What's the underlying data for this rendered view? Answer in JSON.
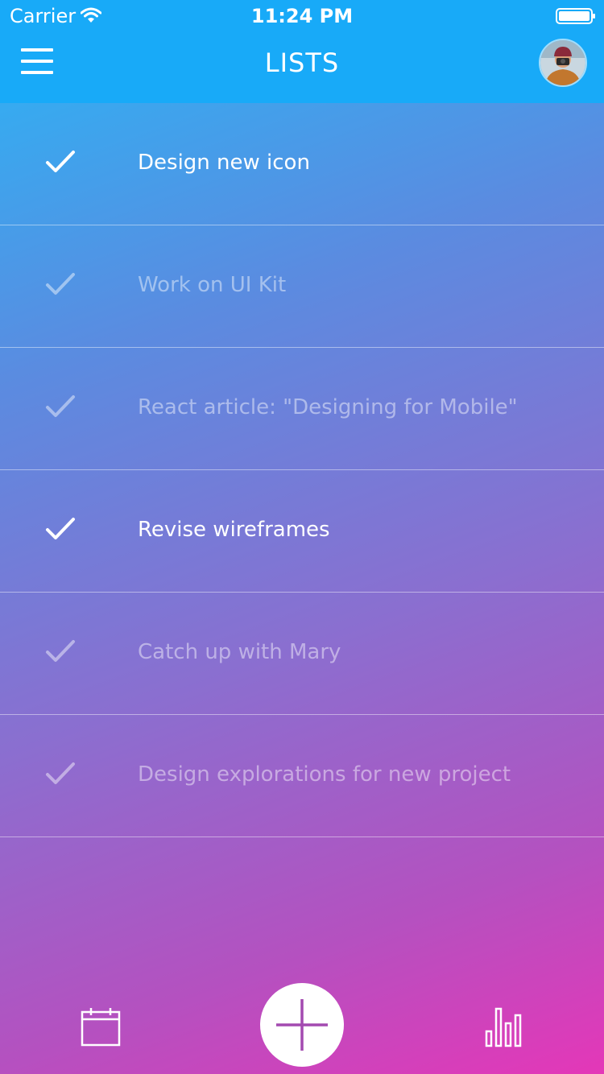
{
  "status_bar": {
    "carrier": "Carrier",
    "time": "11:24 PM",
    "icons": [
      "wifi-icon",
      "battery-icon"
    ]
  },
  "header": {
    "title": "LISTS",
    "menu_icon": "hamburger-menu-icon",
    "avatar": "user-avatar"
  },
  "tasks": [
    {
      "label": "Design new icon",
      "completed": true
    },
    {
      "label": "Work on UI Kit",
      "completed": false
    },
    {
      "label": "React article: \"Designing for Mobile\"",
      "completed": false
    },
    {
      "label": "Revise wireframes",
      "completed": true
    },
    {
      "label": "Catch up with Mary",
      "completed": false
    },
    {
      "label": "Design explorations for new project",
      "completed": false
    }
  ],
  "bottom_bar": {
    "left_icon": "calendar-icon",
    "center_icon": "plus-icon",
    "right_icon": "bar-chart-icon"
  },
  "colors": {
    "header": "#18aaf8",
    "gradient_start": "#29b6f6",
    "gradient_end": "#e437b8",
    "accent": "#a34ab0"
  }
}
